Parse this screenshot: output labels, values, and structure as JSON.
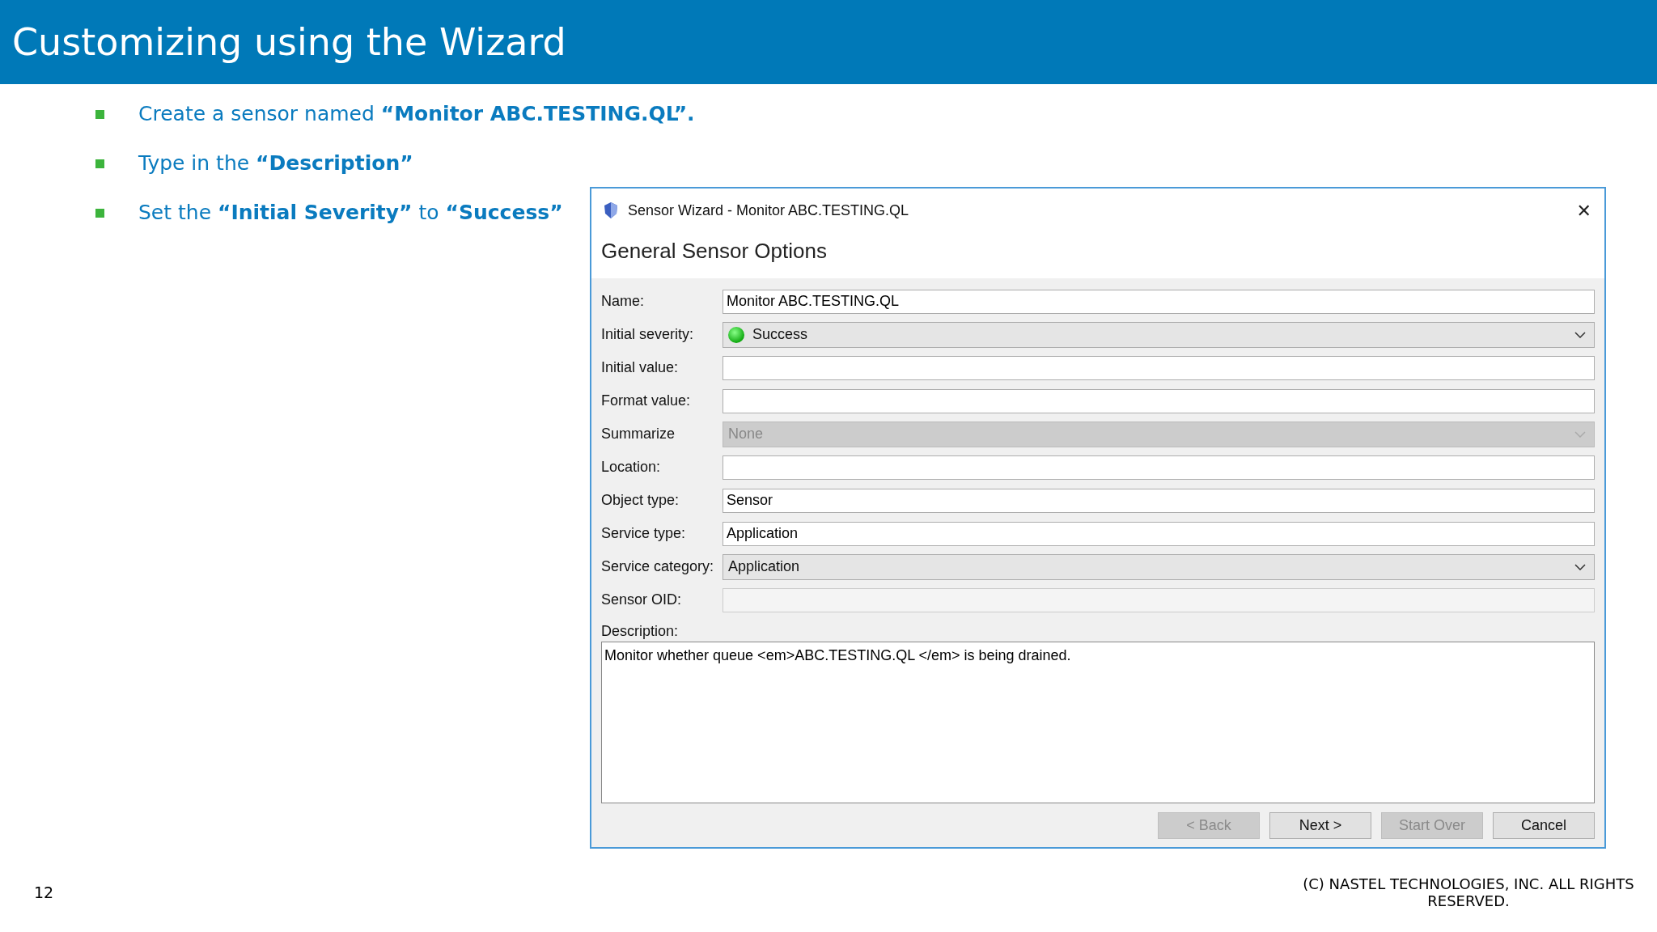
{
  "slide": {
    "title": "Customizing using the Wizard",
    "page_number": "12",
    "copyright": "(C) NASTEL TECHNOLOGIES, INC. ALL RIGHTS RESERVED."
  },
  "bullets": [
    "Create a sensor named **“Monitor ABC.TESTING.QL”.**",
    "Type in the **“Description”**",
    "Set the **“Initial Severity”** to **“Success”**"
  ],
  "dialog": {
    "title": "Sensor Wizard - Monitor ABC.TESTING.QL",
    "close": "✕",
    "heading": "General Sensor Options",
    "fields": [
      {
        "label": "Name:",
        "kind": "text",
        "value": "Monitor ABC.TESTING.QL",
        "disabled": false
      },
      {
        "label": "Initial severity:",
        "kind": "severity",
        "value": "Success",
        "disabled": false
      },
      {
        "label": "Initial value:",
        "kind": "text",
        "disabled": false
      },
      {
        "label": "Format value:",
        "kind": "text",
        "disabled": false
      },
      {
        "label": "Summarize",
        "kind": "dropdown",
        "value": "None",
        "disabled": true
      },
      {
        "label": "Location:",
        "kind": "text",
        "disabled": false
      },
      {
        "label": "Object type:",
        "kind": "text",
        "value": "Sensor",
        "disabled": false
      },
      {
        "label": "Service type:",
        "kind": "text",
        "value": "Application",
        "disabled": false
      },
      {
        "label": "Service category:",
        "kind": "dropdown",
        "value": "Application",
        "disabled": false
      },
      {
        "label": "Sensor OID:",
        "kind": "text",
        "disabled": true
      }
    ],
    "description": {
      "label": "Description:",
      "value": "Monitor whether queue <em>ABC.TESTING.QL </em> is being drained."
    },
    "buttons": [
      {
        "label": "< Back",
        "disabled": true
      },
      {
        "label": "Next >",
        "disabled": false
      },
      {
        "label": "Start Over",
        "disabled": true
      },
      {
        "label": "Cancel",
        "disabled": false
      }
    ]
  }
}
